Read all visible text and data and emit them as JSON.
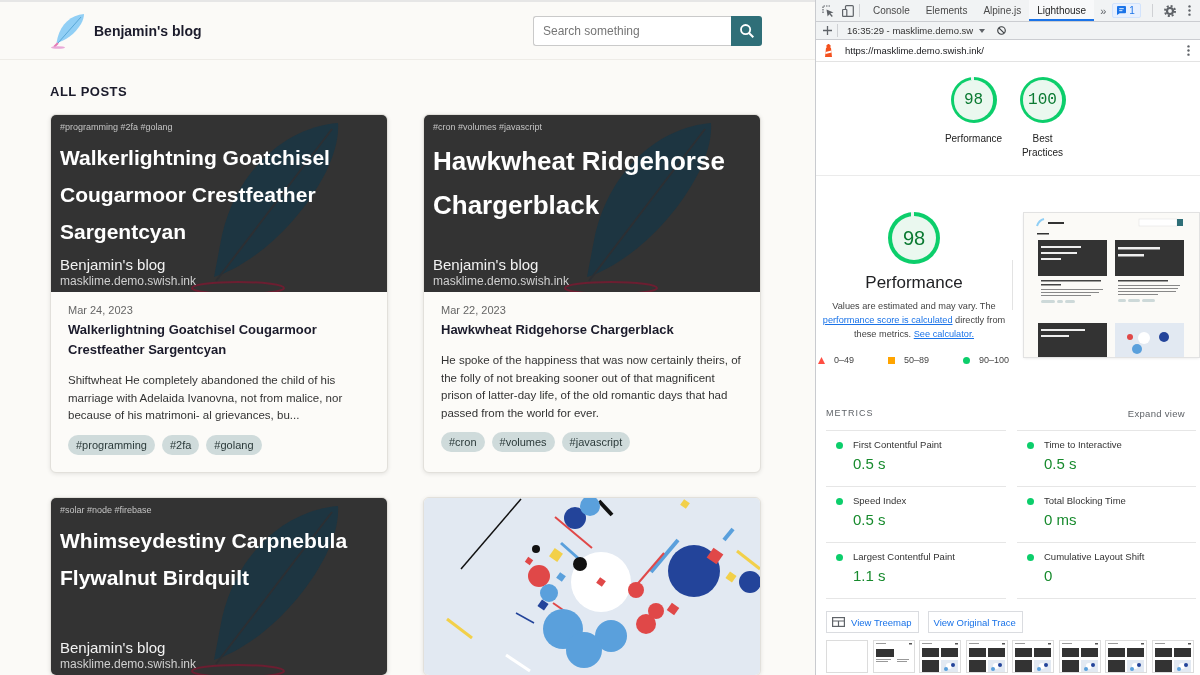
{
  "blog": {
    "site_title": "Benjamin's blog",
    "search": {
      "placeholder": "Search something"
    },
    "section_title": "ALL POSTS",
    "posts": [
      {
        "kind": "text-cover",
        "cover": {
          "tags": "#programming #2fa #golang",
          "title": "Walkerlightning Goatchisel Cougarmoor Crestfeather Sargentcyan",
          "site": "Benjamin's blog",
          "url": "masklime.demo.swish.ink"
        },
        "date": "Mar 24, 2023",
        "title": "Walkerlightning Goatchisel Cougarmoor Crestfeather Sargentcyan",
        "excerpt": "Shiftwheat He completely abandoned the child of his marriage with Adelaida Ivanovna, not from malice, nor because of his matrimoni- al grievances, bu...",
        "tags": [
          "#programming",
          "#2fa",
          "#golang"
        ]
      },
      {
        "kind": "text-cover",
        "cover": {
          "tags": "#cron #volumes #javascript",
          "title": "Hawkwheat Ridgehorse Chargerblack",
          "site": "Benjamin's blog",
          "url": "masklime.demo.swish.ink"
        },
        "date": "Mar 22, 2023",
        "title": "Hawkwheat Ridgehorse Chargerblack",
        "excerpt": "He spoke of the happiness that was now certainly theirs, of the folly of not breaking sooner out of that magnificent prison of latter-day life, of the old romantic days that had passed from the world for ever.",
        "tags": [
          "#cron",
          "#volumes",
          "#javascript"
        ]
      },
      {
        "kind": "text-cover",
        "cover": {
          "tags": "#solar #node #firebase",
          "title": "Whimseydestiny Carpnebula Flywalnut Birdquilt",
          "site": "Benjamin's blog",
          "url": "masklime.demo.swish.ink"
        }
      },
      {
        "kind": "image-cover"
      }
    ]
  },
  "devtools": {
    "tabs": [
      {
        "label": "Console",
        "selected": false
      },
      {
        "label": "Elements",
        "selected": false
      },
      {
        "label": "Alpine.js",
        "selected": false
      },
      {
        "label": "Lighthouse",
        "selected": true
      }
    ],
    "more_tabs": "»",
    "issues_count": "1",
    "report": "16:35:29 - masklime.demo.sw",
    "url": "https://masklime.demo.swish.ink/",
    "category_gauges": [
      {
        "score": "98",
        "passed": true,
        "label": "Performance"
      },
      {
        "score": "100",
        "passed": true,
        "label": "Best Practices"
      }
    ],
    "performance": {
      "score": "98",
      "passed": true,
      "title": "Performance",
      "description": [
        {
          "kind": "text",
          "text": "Values are estimated and may vary. The "
        },
        {
          "kind": "link",
          "text": "performance score is calculated"
        },
        {
          "kind": "text",
          "text": " directly from these metrics. "
        },
        {
          "kind": "link",
          "text": "See calculator."
        }
      ],
      "legend": [
        {
          "kind": "triangle",
          "label": "0–49",
          "color": "#ff4e42"
        },
        {
          "kind": "square",
          "label": "50–89",
          "color": "#ffa400"
        },
        {
          "kind": "circle",
          "label": "90–100",
          "color": "#0cce6b"
        }
      ]
    },
    "metrics": {
      "title": "METRICS",
      "expand_label": "Expand view",
      "items": [
        {
          "label": "First Contentful Paint",
          "value": "0.5 s",
          "passed": true
        },
        {
          "label": "Time to Interactive",
          "value": "0.5 s",
          "passed": true
        },
        {
          "label": "Speed Index",
          "value": "0.5 s",
          "passed": true
        },
        {
          "label": "Total Blocking Time",
          "value": "0 ms",
          "passed": true
        },
        {
          "label": "Largest Contentful Paint",
          "value": "1.1 s",
          "passed": true
        },
        {
          "label": "Cumulative Layout Shift",
          "value": "0",
          "passed": true
        }
      ]
    },
    "actions": [
      {
        "kind": "treemap",
        "label": "View Treemap"
      },
      {
        "kind": "trace",
        "label": "View Original Trace"
      }
    ],
    "filmstrip": [
      {
        "kind": "blank"
      },
      {
        "kind": "partial"
      },
      {
        "kind": "loaded"
      },
      {
        "kind": "loaded"
      },
      {
        "kind": "loaded"
      },
      {
        "kind": "loaded"
      },
      {
        "kind": "loaded"
      },
      {
        "kind": "loaded"
      }
    ]
  }
}
